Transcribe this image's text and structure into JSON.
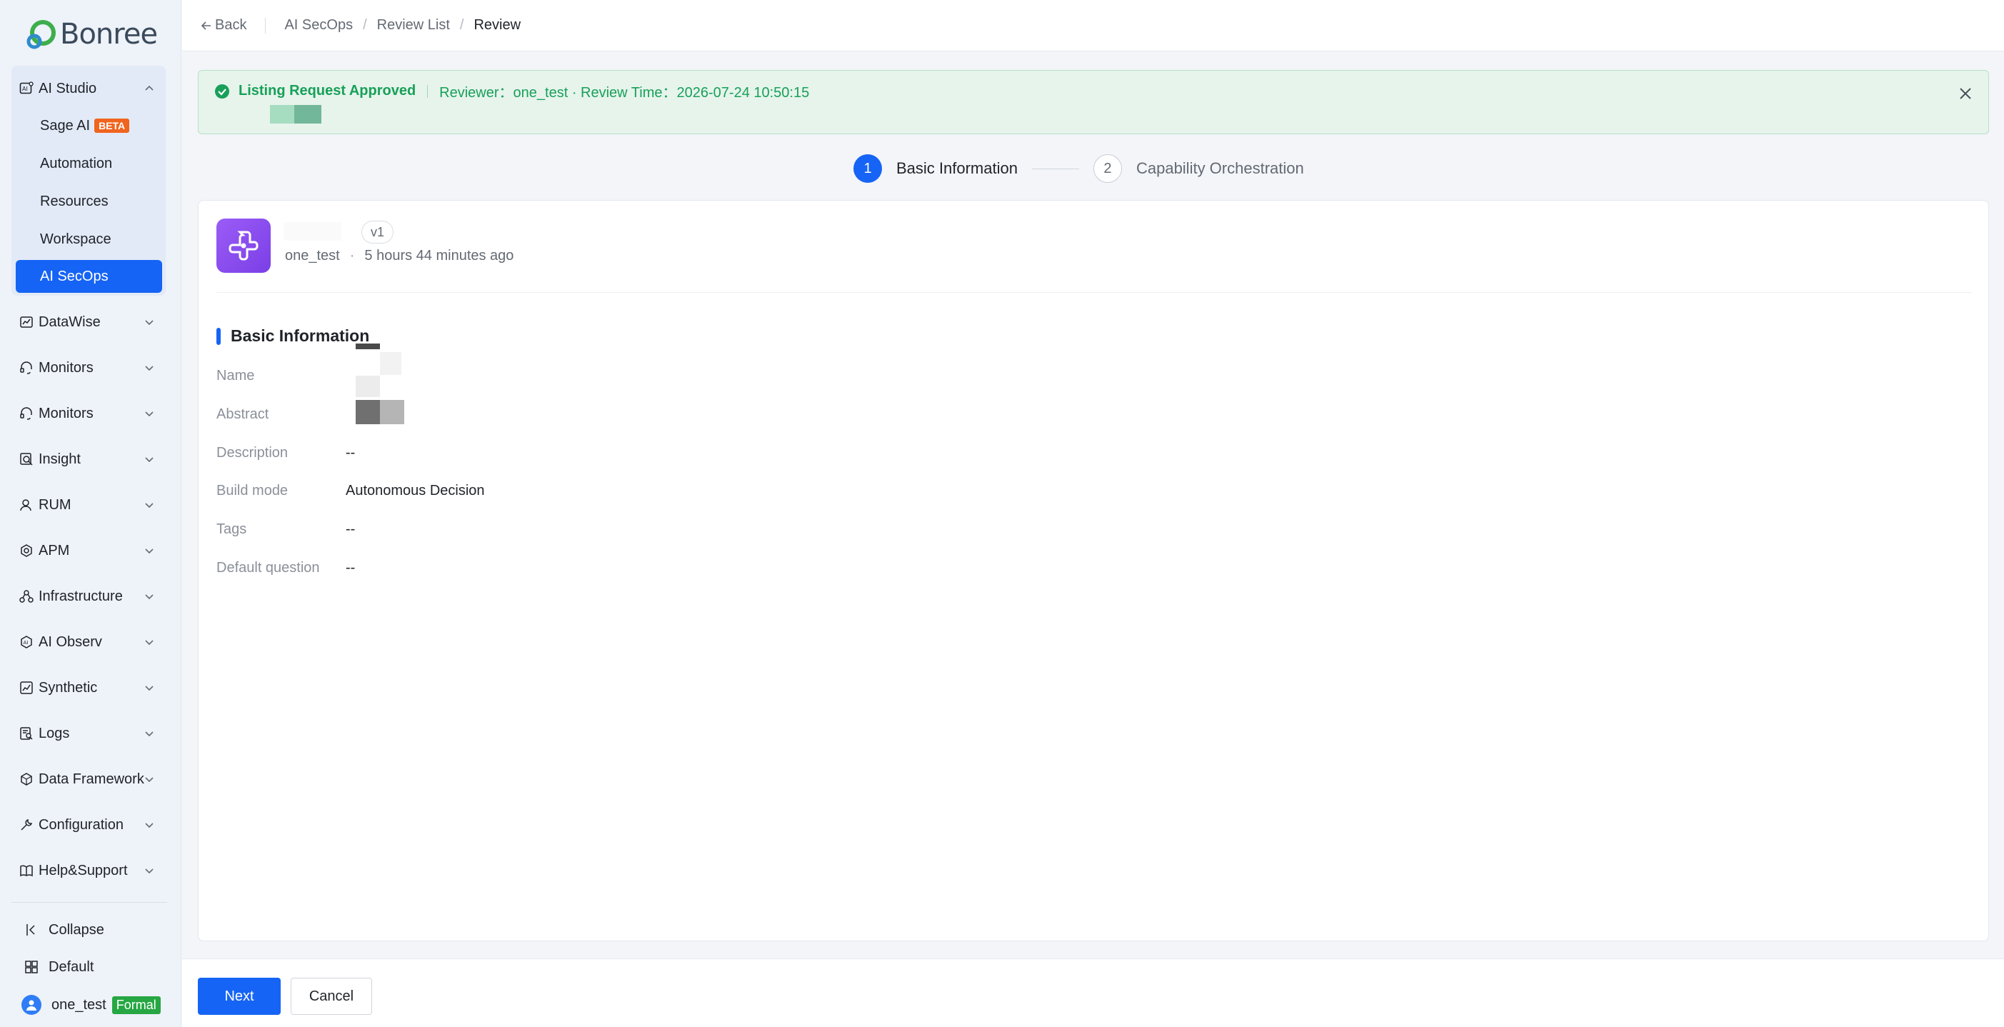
{
  "brand": {
    "name": "Bonree"
  },
  "sidebar": {
    "group_open": {
      "label": "AI Studio",
      "icon": "ai-studio-icon",
      "items": [
        {
          "label": "Sage AI",
          "badge": "BETA"
        },
        {
          "label": "Automation"
        },
        {
          "label": "Resources"
        },
        {
          "label": "Workspace"
        },
        {
          "label": "AI SecOps",
          "active": true
        }
      ]
    },
    "groups": [
      {
        "label": "DataWise",
        "icon": "chart-icon"
      },
      {
        "label": "Monitors",
        "icon": "headset-icon"
      },
      {
        "label": "Monitors",
        "icon": "headset-icon"
      },
      {
        "label": "Insight",
        "icon": "magnifier-icon"
      },
      {
        "label": "RUM",
        "icon": "user-icon"
      },
      {
        "label": "APM",
        "icon": "apm-icon"
      },
      {
        "label": "Infrastructure",
        "icon": "infrastructure-icon"
      },
      {
        "label": "AI Observ",
        "icon": "ai-observ-icon"
      },
      {
        "label": "Synthetic",
        "icon": "synthetic-icon"
      },
      {
        "label": "Logs",
        "icon": "logs-icon"
      },
      {
        "label": "Data Framework",
        "icon": "data-framework-icon"
      },
      {
        "label": "Configuration",
        "icon": "wrench-icon"
      },
      {
        "label": "Help&Support",
        "icon": "book-icon"
      }
    ],
    "footer": {
      "collapse": "Collapse",
      "workspace": "Default",
      "user": "one_test",
      "user_badge": "Formal"
    }
  },
  "topbar": {
    "back": "Back",
    "breadcrumbs": [
      "AI SecOps",
      "Review List",
      "Review"
    ]
  },
  "alert": {
    "title": "Listing Request Approved",
    "meta": "Reviewer：one_test · Review Time：2026-07-24 10:50:15",
    "color": "#18a058"
  },
  "steps": [
    {
      "num": "1",
      "label": "Basic Information",
      "active": true
    },
    {
      "num": "2",
      "label": "Capability Orchestration",
      "active": false
    }
  ],
  "app": {
    "version": "v1",
    "owner": "one_test",
    "time_ago": "5 hours 44 minutes ago"
  },
  "section": {
    "title": "Basic Information",
    "fields": [
      {
        "label": "Name",
        "value": ""
      },
      {
        "label": "Abstract",
        "value": ""
      },
      {
        "label": "Description",
        "value": "--"
      },
      {
        "label": "Build mode",
        "value": "Autonomous Decision"
      },
      {
        "label": "Tags",
        "value": "--"
      },
      {
        "label": "Default question",
        "value": "--"
      }
    ]
  },
  "actions": {
    "next": "Next",
    "cancel": "Cancel"
  },
  "colors": {
    "primary": "#1664f5",
    "success": "#18a058",
    "beta": "#f0641e",
    "formal": "#27a743",
    "app_icon": "#8b4ef0"
  }
}
